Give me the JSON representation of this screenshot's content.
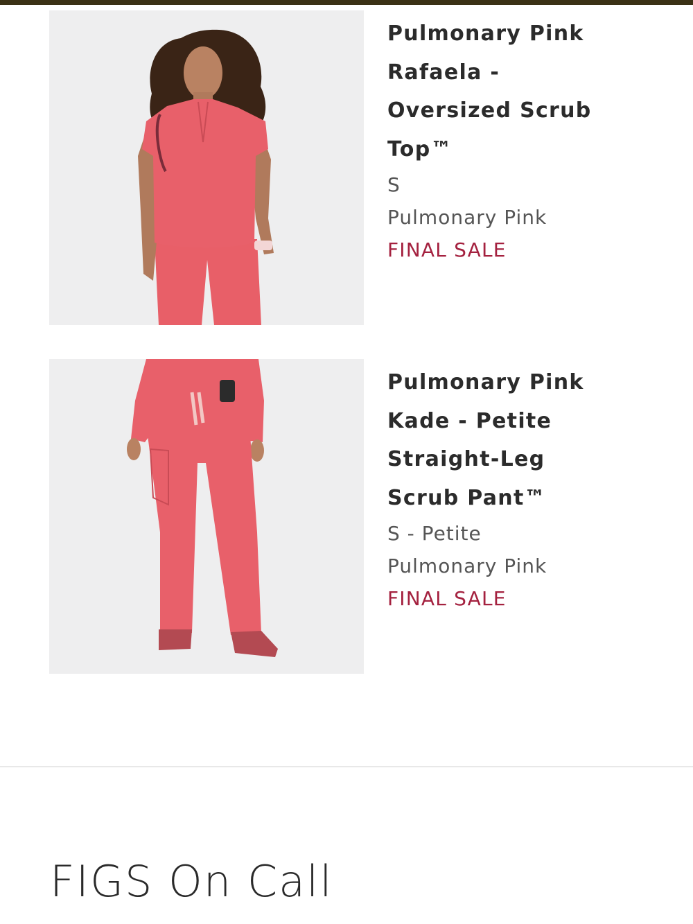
{
  "colors": {
    "top_bar": "#3b3115",
    "final_sale": "#a4213f",
    "product_pink": "#e8606a"
  },
  "products": [
    {
      "name_lines": [
        "Pulmonary Pink",
        "Rafaela -",
        "Oversized Scrub",
        "Top™"
      ],
      "size": "S",
      "color": "Pulmonary Pink",
      "status": "FINAL SALE",
      "image": "woman-wearing-pink-scrub-top"
    },
    {
      "name_lines": [
        "Pulmonary Pink",
        "Kade - Petite",
        "Straight-Leg",
        "Scrub Pant™"
      ],
      "size": "S - Petite",
      "color": "Pulmonary Pink",
      "status": "FINAL SALE",
      "image": "pink-straight-leg-scrub-pant"
    }
  ],
  "section": {
    "title": "FIGS On Call"
  }
}
